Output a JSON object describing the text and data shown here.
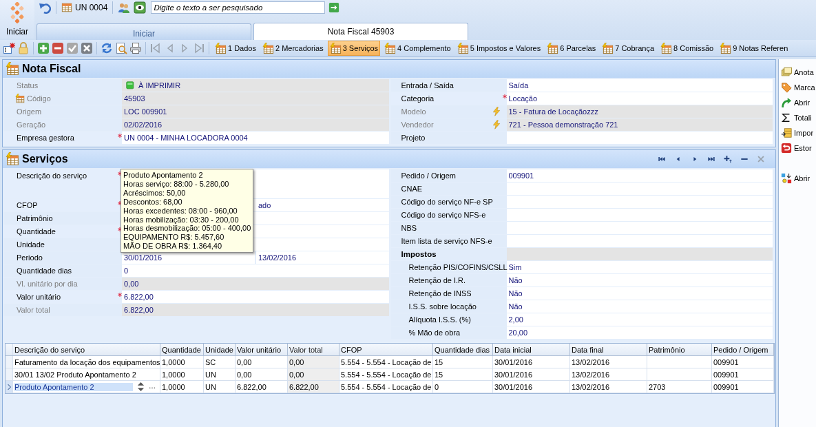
{
  "app": {
    "start_label": "Iniciar"
  },
  "quick_bar": {
    "unit": "UN 0004",
    "search": {
      "placeholder": "Digite o texto a ser pesquisado"
    }
  },
  "doc_tabs": [
    {
      "label": "Iniciar",
      "selected": false
    },
    {
      "label": "Nota Fiscal 45903",
      "selected": true
    }
  ],
  "record_tabs": [
    {
      "label": "1 Dados",
      "selected": false
    },
    {
      "label": "2 Mercadorias",
      "selected": false
    },
    {
      "label": "3 Serviços",
      "selected": true
    },
    {
      "label": "4 Complemento",
      "selected": false
    },
    {
      "label": "5 Impostos e Valores",
      "selected": false
    },
    {
      "label": "6 Parcelas",
      "selected": false
    },
    {
      "label": "7 Cobrança",
      "selected": false
    },
    {
      "label": "8 Comissão",
      "selected": false
    },
    {
      "label": "9 Notas Referen",
      "selected": false
    }
  ],
  "nota_fiscal": {
    "title": "Nota Fiscal",
    "left_fields": [
      {
        "label": "Status",
        "value": "À IMPRIMIR",
        "kind": "status",
        "required": false,
        "readonly": true
      },
      {
        "label": "Código",
        "value": "45903",
        "kind": "key",
        "required": false,
        "readonly": true
      },
      {
        "label": "Origem",
        "value": "LOC 009901",
        "required": false,
        "readonly": true
      },
      {
        "label": "Geração",
        "value": "02/02/2016",
        "required": false,
        "readonly": true
      },
      {
        "label": "Empresa gestora",
        "value": "UN 0004 - MINHA LOCADORA 0004",
        "required": true,
        "readonly": false
      }
    ],
    "right_fields": [
      {
        "label": "Entrada / Saída",
        "value": "Saída",
        "required": false,
        "readonly": false
      },
      {
        "label": "Categoria",
        "value": "Locação",
        "required": true,
        "readonly": false
      },
      {
        "label": "Modelo",
        "value": "15 - Fatura de Locaçãozzz",
        "kind": "lookup",
        "required": false,
        "readonly": true
      },
      {
        "label": "Vendedor",
        "value": "721 - Pessoa demonstração 721",
        "kind": "lookup",
        "required": false,
        "readonly": true
      },
      {
        "label": "Projeto",
        "required": false,
        "readonly": false
      }
    ]
  },
  "servicos": {
    "title": "Serviços",
    "left_fields": [
      {
        "label": "Descrição do serviço",
        "kind": "memo",
        "required": true,
        "readonly": false
      },
      {
        "label": "CFOP",
        "value": "ado",
        "kind": "covered",
        "required": true,
        "readonly": false
      },
      {
        "label": "Patrimônio",
        "required": false,
        "readonly": false
      },
      {
        "label": "Quantidade",
        "required": true,
        "readonly": false
      },
      {
        "label": "Unidade",
        "required": false,
        "readonly": false
      },
      {
        "label": "Periodo",
        "values": [
          "30/01/2016",
          "13/02/2016"
        ],
        "kind": "range",
        "required": false,
        "readonly": false
      },
      {
        "label": "Quantidade dias",
        "value": "0",
        "required": false,
        "readonly": false
      },
      {
        "label": "Vl. unitário por dia",
        "value": "0,00",
        "required": false,
        "readonly": true
      },
      {
        "label": "Valor unitário",
        "value": "6.822,00",
        "required": true,
        "readonly": false
      },
      {
        "label": "Valor total",
        "value": "6.822,00",
        "required": false,
        "readonly": true
      }
    ],
    "right_fields": [
      {
        "label": "Pedido / Origem",
        "value": "009901",
        "required": false,
        "readonly": false
      },
      {
        "label": "CNAE",
        "required": false,
        "readonly": false
      },
      {
        "label": "Código do serviço NF-e SP",
        "required": false,
        "readonly": false
      },
      {
        "label": "Código do serviço NFS-e",
        "required": false,
        "readonly": false
      },
      {
        "label": "NBS",
        "required": false,
        "readonly": false
      },
      {
        "label": "Item lista de serviço NFS-e",
        "required": false,
        "readonly": false
      },
      {
        "label": "Impostos",
        "kind": "group",
        "required": false,
        "readonly": true,
        "children": [
          {
            "label": "Retenção PIS/COFINS/CSLL",
            "value": "Sim",
            "required": false,
            "readonly": false
          },
          {
            "label": "Retenção de I.R.",
            "value": "Não",
            "required": false,
            "readonly": false
          },
          {
            "label": "Retenção de INSS",
            "value": "Não",
            "required": false,
            "readonly": false
          },
          {
            "label": "I.S.S. sobre locação",
            "value": "Não",
            "required": false,
            "readonly": false
          },
          {
            "label": "Alíquota I.S.S. (%)",
            "value": "2,00",
            "required": false,
            "readonly": false
          },
          {
            "label": "% Mão de obra",
            "value": "20,00",
            "required": false,
            "readonly": false
          }
        ]
      }
    ],
    "tooltip": {
      "lines": [
        "Produto Apontamento 2",
        "Horas serviço: 88:00 - 5.280,00",
        "Acréscimos: 50,00",
        "Descontos: 68,00",
        "Horas excedentes: 08:00 - 960,00",
        "Horas mobilização: 03:30 - 200,00",
        "Horas desmobilização: 05:00 - 400,00",
        "EQUIPAMENTO R$: 5.457,60",
        "MÃO DE OBRA R$: 1.364,40"
      ]
    }
  },
  "table": {
    "columns": [
      {
        "label": "Descrição do serviço",
        "readonly": false
      },
      {
        "label": "Quantidade",
        "readonly": false
      },
      {
        "label": "Unidade",
        "readonly": false
      },
      {
        "label": "Valor unitário",
        "readonly": false
      },
      {
        "label": "Valor total",
        "readonly": true
      },
      {
        "label": "CFOP",
        "readonly": false
      },
      {
        "label": "Quantidade dias",
        "readonly": false
      },
      {
        "label": "Data inicial",
        "readonly": false
      },
      {
        "label": "Data final",
        "readonly": false
      },
      {
        "label": "Patrimônio",
        "readonly": false
      },
      {
        "label": "Pedido / Origem",
        "readonly": false
      }
    ],
    "rows": [
      {
        "selected": false,
        "cells": [
          "Faturamento da locação dos equipamentos",
          "1,0000",
          "SC",
          "0,00",
          "0,00",
          "5.554 - 5.554 - Locação de",
          "15",
          "30/01/2016",
          "13/02/2016",
          "",
          "009901"
        ]
      },
      {
        "selected": false,
        "cells": [
          "30/01 13/02 Produto Apontamento 2",
          "1,0000",
          "UN",
          "0,00",
          "0,00",
          "5.554 - 5.554 - Locação de",
          "15",
          "30/01/2016",
          "13/02/2016",
          "",
          "009901"
        ]
      },
      {
        "selected": true,
        "cells": [
          "Produto Apontamento 2",
          "1,0000",
          "UN",
          "6.822,00",
          "6.822,00",
          "5.554 - 5.554 - Locação de",
          "0",
          "30/01/2016",
          "13/02/2016",
          "2703",
          "009901"
        ]
      }
    ]
  },
  "side_actions": [
    {
      "label": "Anota"
    },
    {
      "label": "Marca"
    },
    {
      "label": "Abrir"
    },
    {
      "label": "Totali"
    },
    {
      "label": "Impor"
    },
    {
      "label": "Estor"
    },
    {
      "label": "Abrir"
    }
  ]
}
